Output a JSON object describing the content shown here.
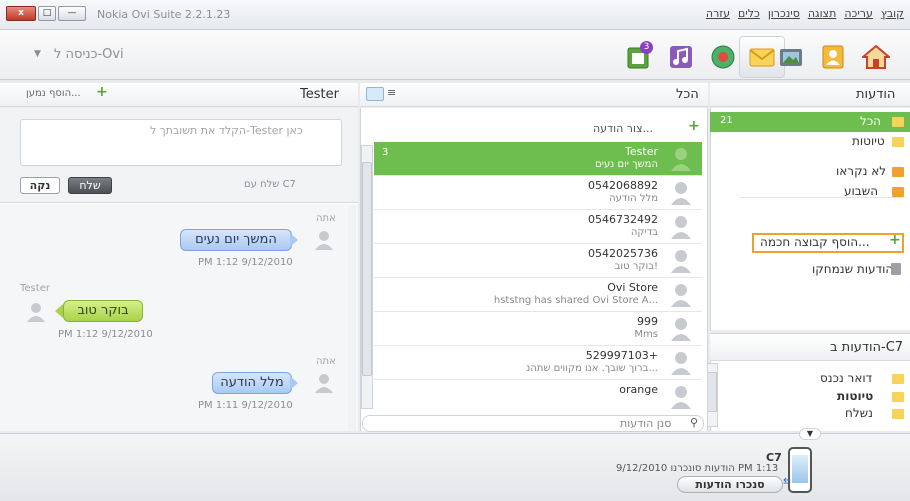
{
  "window": {
    "title": "Nokia Ovi Suite 2.2.1.23",
    "close_label": "x",
    "max_label": "□",
    "min_label": "—"
  },
  "menu": [
    "קובץ",
    "עריכה",
    "תצוגה",
    "סינכרון",
    "כלים",
    "עזרה"
  ],
  "toolbar": {
    "ovi_login": "כניסה ל-Ovi",
    "badge_count": "3"
  },
  "left_panel": {
    "contact_name": "Tester",
    "add_recipient": "הוסף נמען...",
    "compose_placeholder": "הקלד את תשובתך ל-Tester כאן",
    "send_label": "שלח",
    "clear_label": "נקה",
    "send_with": "שלח עם C7",
    "messages": [
      {
        "who": "אתה",
        "text": "המשך יום נעים",
        "time": "PM 1:12 9/12/2010",
        "dir": "out"
      },
      {
        "who": "Tester",
        "text": "בוקר טוב",
        "time": "PM 1:12 9/12/2010",
        "dir": "in"
      },
      {
        "who": "אתה",
        "text": "מלל הודעה",
        "time": "PM 1:11 9/12/2010",
        "dir": "out"
      }
    ]
  },
  "list_panel": {
    "title": "הכל",
    "new_message": "צור הודעה...",
    "search_placeholder": "סנן הודעות",
    "conversations": [
      {
        "name": "Tester",
        "preview": "המשך יום נעים",
        "count": "3",
        "selected": true
      },
      {
        "name": "0542068892",
        "preview": "מלל הודעה",
        "count": "",
        "selected": false
      },
      {
        "name": "0546732492",
        "preview": "בדיקה",
        "count": "",
        "selected": false
      },
      {
        "name": "0542025736",
        "preview": "בוקר טוב!",
        "count": "",
        "selected": false
      },
      {
        "name": "Ovi Store",
        "preview": "hststng has shared Ovi Store A...",
        "count": "",
        "selected": false
      },
      {
        "name": "999",
        "preview": "Mms",
        "count": "",
        "selected": false
      },
      {
        "name": "529997103+",
        "preview": "ברוך שובך. אנו מקווים שתהנ...",
        "count": "",
        "selected": false
      },
      {
        "name": "orange",
        "preview": "",
        "count": "",
        "selected": false
      }
    ]
  },
  "folders_panel": {
    "title": "הודעות",
    "all": {
      "label": "הכל",
      "count": "21"
    },
    "drafts": "טיוטות",
    "unread": "לא נקראו",
    "this_week": "השבוע",
    "add_smart_folder": "הוסף קבוצה חכמה...",
    "deleted": "הודעות שנמחקו"
  },
  "device_panel": {
    "title": "הודעות ב-C7",
    "inbox": "דואר נכנס",
    "drafts": "טיוטות",
    "sent": "נשלח"
  },
  "bottom": {
    "device_name": "C7",
    "sync_status": "הודעות סונכרנו 9/12/2010 PM 1:13",
    "sync_button": "סנכרו הודעות"
  },
  "colors": {
    "accent_green": "#6ebd4f",
    "smart_folder_border": "#f0a030",
    "bubble_blue": "#aac9f2",
    "bubble_green": "#a8d24a"
  }
}
